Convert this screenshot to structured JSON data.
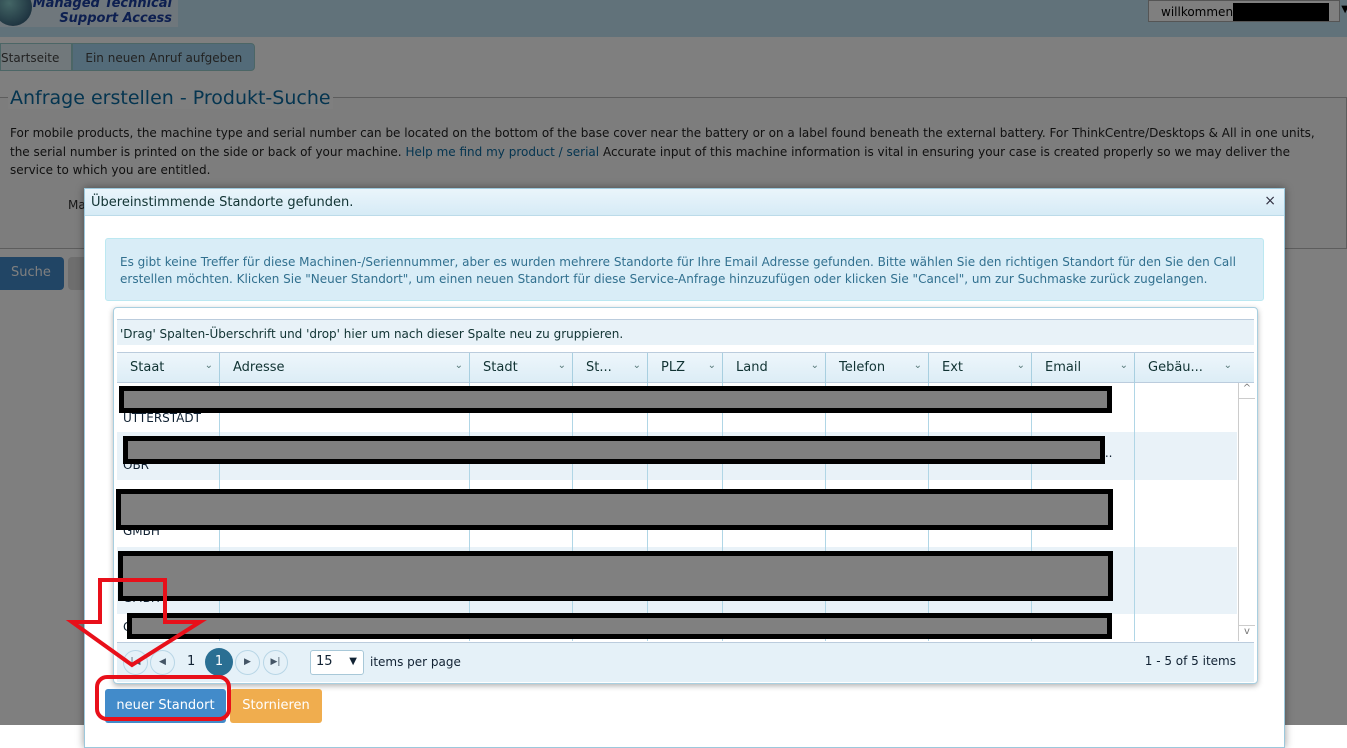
{
  "header": {
    "logo_line1": "Managed Technical",
    "logo_line2": "Support Access",
    "welcome": "willkommen"
  },
  "nav": {
    "tabs": [
      {
        "label": "Startseite"
      },
      {
        "label": "Ein neuen Anruf aufgeben",
        "active": true
      }
    ]
  },
  "page": {
    "title": "Anfrage erstellen - Produkt-Suche",
    "desc_before": "For mobile products, the machine type and serial number can be located on the bottom of the base cover near the battery or on a label found beneath the external battery. For ThinkCentre/Desktops & All in one units, the serial number is printed on the side or back of your machine. ",
    "help_link": "Help me find my product / serial",
    "desc_after": " Accurate input of this machine information is vital in ensuring your case is created properly so we may deliver the service to which you are entitled.",
    "field_label_partial": "Ma",
    "search_button": "Suche"
  },
  "modal": {
    "title": "Übereinstimmende Standorte gefunden.",
    "close": "×",
    "info": "Es gibt keine Treffer für diese Machinen-/Seriennummer, aber es wurden mehrere Standorte für Ihre Email Adresse gefunden. Bitte wählen Sie den richtigen Standort für den Sie den Call erstellen möchten. Klicken Sie \"Neuer Standort\", um einen neuen Standort für diese Service-Anfrage hinzuzufügen oder klicken Sie \"Cancel\", um zur Suchmaske zurück zugelangen.",
    "group_hint": "'Drag' Spalten-Überschrift und 'drop' hier um nach dieser Spalte neu zu gruppieren.",
    "columns": [
      "Staat",
      "Adresse",
      "Stadt",
      "St...",
      "PLZ",
      "Land",
      "Telefon",
      "Ext",
      "Email",
      "Gebäu..."
    ],
    "rows": [
      {
        "visible_text": "UTTERSTADT"
      },
      {
        "visible_text": "OBR",
        "trailing": "..."
      },
      {
        "visible_text": "GMBH"
      },
      {
        "visible_text": "GMBH"
      },
      {
        "visible_text": "C"
      }
    ],
    "pager": {
      "current_page": "1",
      "page_label": "1",
      "page_size": "15",
      "items_per_page": "items per page",
      "summary": "1 - 5 of 5 items"
    },
    "new_location_button": "neuer Standort",
    "cancel_button": "Stornieren"
  },
  "colors": {
    "primary": "#428bca",
    "warning": "#f0ad4e",
    "annotation": "#e8101a"
  }
}
